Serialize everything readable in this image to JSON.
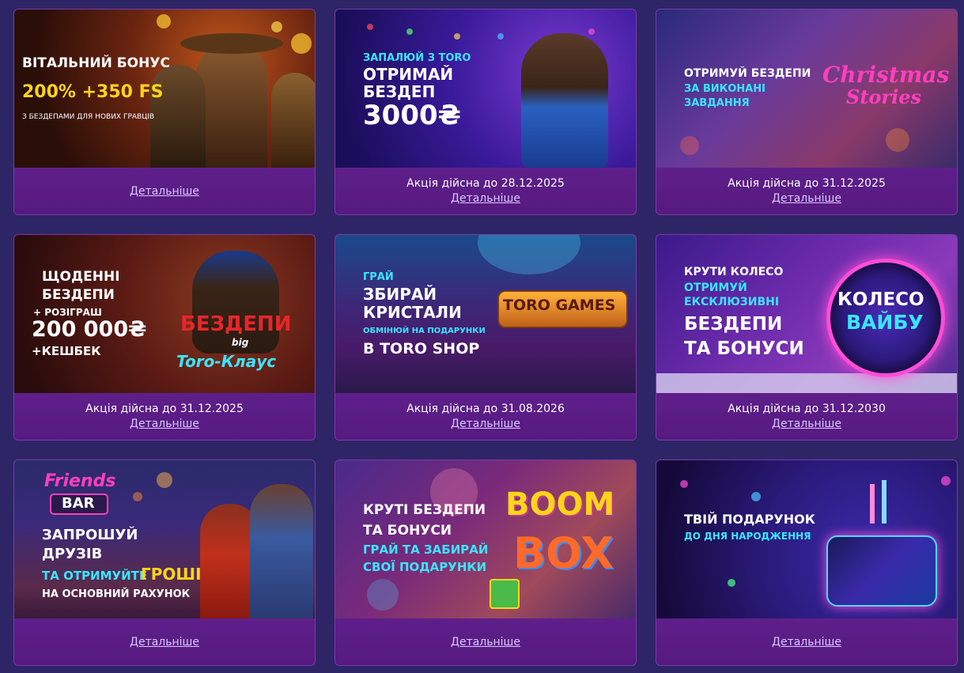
{
  "promos": [
    {
      "lines": [
        "ВІТАЛЬНИЙ БОНУС",
        "200% +350 FS",
        "З БЕЗДЕПАМИ ДЛЯ НОВИХ ГРАВЦІВ"
      ],
      "valid": "",
      "more": "Детальніше"
    },
    {
      "lines": [
        "ЗАПАЛЮЙ З TORO",
        "ОТРИМАЙ",
        "БЕЗДЕП",
        "3000₴"
      ],
      "valid": "Акція дійсна до 28.12.2025",
      "more": "Детальніше"
    },
    {
      "lines": [
        "ОТРИМУЙ БЕЗДЕПИ",
        "ЗА ВИКОНАНІ",
        "ЗАВДАННЯ"
      ],
      "logo": [
        "Christmas",
        "Stories"
      ],
      "valid": "Акція дійсна до 31.12.2025",
      "more": "Детальніше"
    },
    {
      "lines": [
        "ЩОДЕННІ",
        "БЕЗДЕПИ",
        "+ РОЗІГРАШ",
        "200 000₴",
        "+КЕШБЕК"
      ],
      "logo": [
        "БЕЗДЕПИ",
        "big",
        "Toro-Клаус"
      ],
      "valid": "Акція дійсна до 31.12.2025",
      "more": "Детальніше"
    },
    {
      "lines": [
        "ГРАЙ",
        "ЗБИРАЙ",
        "КРИСТАЛИ",
        "ОБМІНЮЙ НА ПОДАРУНКИ",
        "В TORO SHOP"
      ],
      "logo": [
        "TORO GAMES"
      ],
      "valid": "Акція дійсна до 31.08.2026",
      "more": "Детальніше"
    },
    {
      "lines": [
        "КРУТИ КОЛЕСО",
        "ОТРИМУЙ",
        "ЕКСКЛЮЗИВНІ",
        "БЕЗДЕПИ",
        "ТА БОНУСИ"
      ],
      "logo": [
        "КОЛЕСО",
        "ВАЙБУ"
      ],
      "valid": "Акція дійсна до 31.12.2030",
      "more": "Детальніше"
    },
    {
      "lines": [
        "ЗАПРОШУЙ",
        "ДРУЗІВ",
        "ТА ОТРИМУЙТЕ",
        "ГРОШІ",
        "НА ОСНОВНИЙ РАХУНОК"
      ],
      "logo": [
        "Friends",
        "BAR"
      ],
      "valid": "",
      "more": "Детальніше"
    },
    {
      "lines": [
        "КРУТІ БЕЗДЕПИ",
        "ТА БОНУСИ",
        "ГРАЙ ТА ЗАБИРАЙ",
        "СВОЇ ПОДАРУНКИ"
      ],
      "logo": [
        "BOOM",
        "BOX"
      ],
      "valid": "",
      "more": "Детальніше"
    },
    {
      "lines": [
        "ТВІЙ ПОДАРУНОК",
        "ДО ДНЯ НАРОДЖЕННЯ"
      ],
      "valid": "",
      "more": "Детальніше"
    }
  ]
}
